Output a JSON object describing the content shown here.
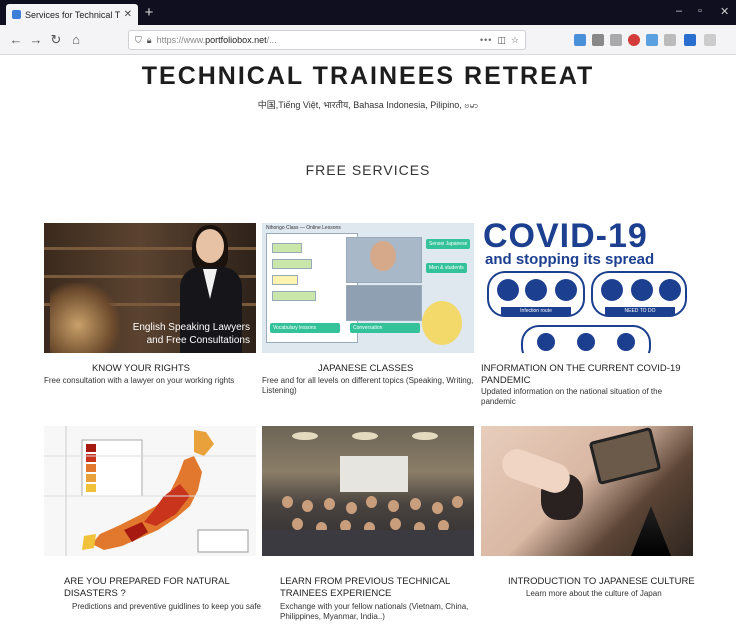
{
  "browser": {
    "tab_title": "Services for Technical Trainee",
    "url_prefix": "https://www.",
    "url_domain": "portfoliobox.net",
    "url_rest": "/..."
  },
  "page": {
    "title": "TECHNICAL TRAINEES RETREAT",
    "languages": "中国,Tiếng Việt, भारतीय, Bahasa Indonesia, Pilipino, ဗမာ",
    "section_title": "FREE SERVICES"
  },
  "cards": [
    {
      "title": "KNOW YOUR RIGHTS",
      "desc": "Free consultation with a lawyer on your working rights",
      "image_caption_1": "English Speaking Lawyers",
      "image_caption_2": "and Free Consultations"
    },
    {
      "title": "JAPANESE CLASSES",
      "desc": "Free and for all levels on different topics (Speaking, Writing, Listening)"
    },
    {
      "title": "INFORMATION ON THE CURRENT COVID-19 PANDEMIC",
      "desc": "Updated information on the national situation of the pandemic",
      "image_heading": "COVID-19",
      "image_sub": "and stopping its spread",
      "image_bar_1": "Infection route",
      "image_bar_2": "NEED TO DO"
    },
    {
      "title": "ARE YOU PREPARED FOR NATURAL DISASTERS ?",
      "desc": "Predictions and preventive guidlines to keep you safe"
    },
    {
      "title": "LEARN FROM PREVIOUS TECHNICAL TRAINEES EXPERIENCE",
      "desc": "Exchange with your fellow nationals (Vietnam, China, Philippines, Myanmar, India..)"
    },
    {
      "title": "INTRODUCTION TO JAPANESE CULTURE",
      "desc": "Learn more about the culture of Japan"
    }
  ]
}
